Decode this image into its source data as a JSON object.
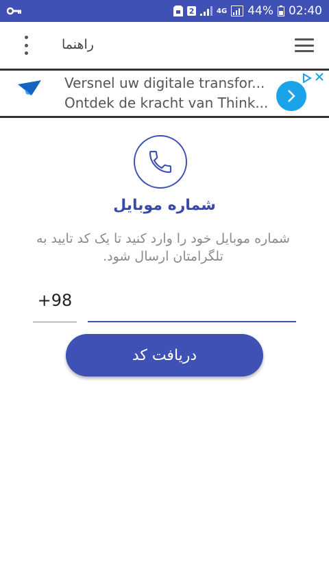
{
  "status_bar": {
    "sim_badge": "2",
    "network": "4G",
    "battery": "44%",
    "time": "02:40"
  },
  "app_bar": {
    "title": "راهنما"
  },
  "ad": {
    "line1": "Versnel uw digitale transfor...",
    "line2": "Ontdek de kracht van Think..."
  },
  "main": {
    "title": "شماره موبایل",
    "description": "شماره موبایل خود را وارد کنید تا یک کد تایید به تلگرامتان ارسال شود.",
    "country_code": "+98",
    "phone_value": "",
    "phone_placeholder": "",
    "submit_label": "دریافت کد"
  },
  "colors": {
    "primary": "#3f51b5",
    "ad_button": "#1aa3e8"
  },
  "icons": {
    "key": "key-icon",
    "sim": "sim-icon",
    "signal": "signal-icon",
    "battery": "battery-icon",
    "menu": "overflow-menu-icon",
    "hamburger": "hamburger-icon",
    "phone": "phone-icon"
  }
}
